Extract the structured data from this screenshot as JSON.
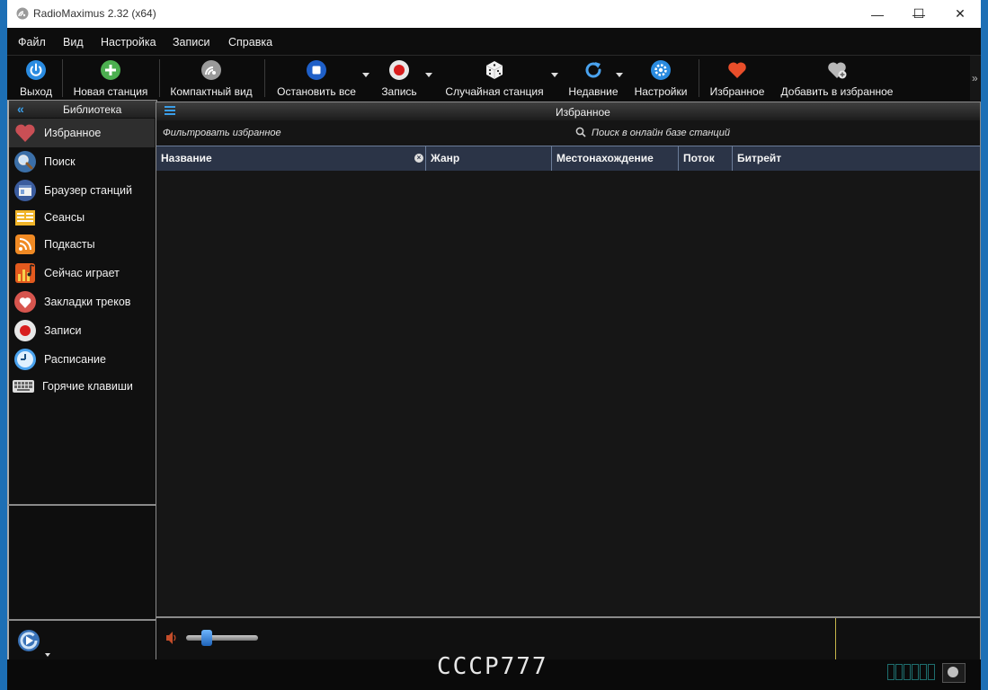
{
  "window": {
    "title": "RadioMaximus 2.32 (x64)",
    "controls": {
      "minimize": "—",
      "maximize": "☐",
      "close": "✕"
    }
  },
  "menu": [
    "Файл",
    "Вид",
    "Настройка",
    "Записи",
    "Справка"
  ],
  "toolbar": {
    "exit": "Выход",
    "new_station": "Новая станция",
    "compact_view": "Компактный вид",
    "stop_all": "Остановить все",
    "record": "Запись",
    "random_station": "Случайная станция",
    "recent": "Недавние",
    "settings": "Настройки",
    "favorites": "Избранное",
    "add_to_favorites": "Добавить в избранное",
    "more": "»"
  },
  "sidebar": {
    "header": "Библиотека",
    "collapse": "«",
    "items": [
      {
        "label": "Избранное",
        "icon": "heart-icon"
      },
      {
        "label": "Поиск",
        "icon": "magnifier-icon"
      },
      {
        "label": "Браузер станций",
        "icon": "browser-icon"
      },
      {
        "label": "Сеансы",
        "icon": "sessions-icon"
      },
      {
        "label": "Подкасты",
        "icon": "rss-icon"
      },
      {
        "label": "Сейчас играет",
        "icon": "now-playing-icon"
      },
      {
        "label": "Закладки треков",
        "icon": "bookmark-heart-icon"
      },
      {
        "label": "Записи",
        "icon": "record-icon"
      },
      {
        "label": "Расписание",
        "icon": "clock-icon"
      },
      {
        "label": "Горячие клавиши",
        "icon": "keyboard-icon"
      }
    ],
    "active_index": 0
  },
  "main": {
    "title": "Избранное",
    "filter_label": "Фильтровать избранное",
    "search_online_label": "Поиск в онлайн базе станций",
    "columns": [
      "Название",
      "Жанр",
      "Местонахождение",
      "Поток",
      "Битрейт"
    ],
    "rows": []
  },
  "player": {
    "volume": 0.25
  },
  "statusbar": {
    "watermark": "CCCP777"
  },
  "colors": {
    "accent_blue": "#3a9ee8",
    "table_header": "#2b3447",
    "window_border": "#1d6fb5",
    "player_divider": "#c7b54a"
  }
}
